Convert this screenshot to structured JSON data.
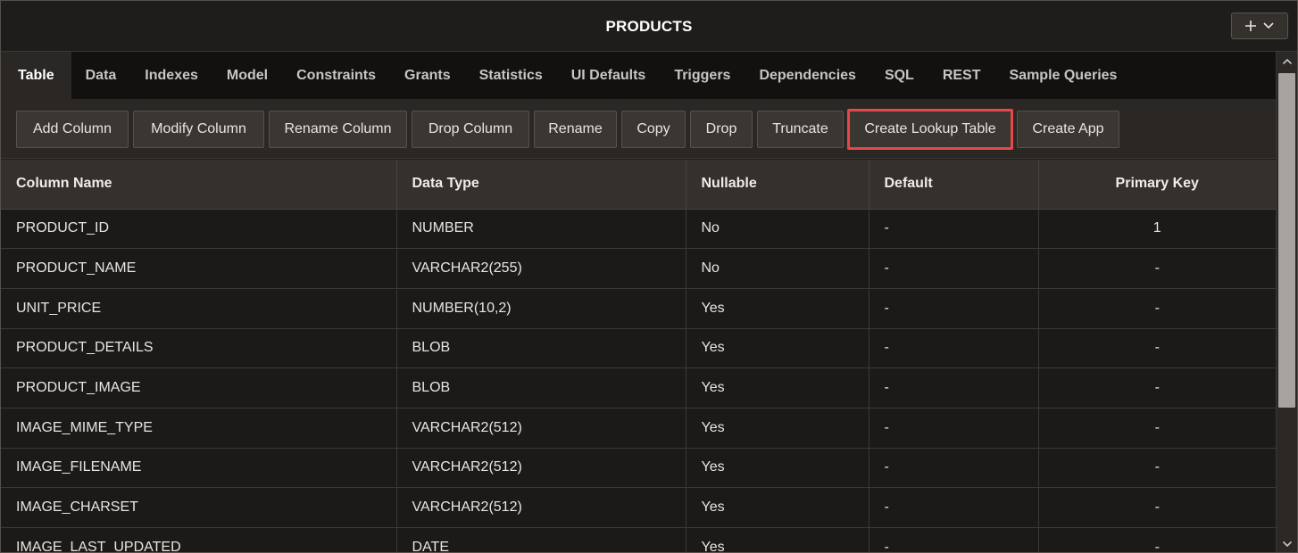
{
  "title": "PRODUCTS",
  "tabs": [
    {
      "label": "Table",
      "active": true
    },
    {
      "label": "Data"
    },
    {
      "label": "Indexes"
    },
    {
      "label": "Model"
    },
    {
      "label": "Constraints"
    },
    {
      "label": "Grants"
    },
    {
      "label": "Statistics"
    },
    {
      "label": "UI Defaults"
    },
    {
      "label": "Triggers"
    },
    {
      "label": "Dependencies"
    },
    {
      "label": "SQL"
    },
    {
      "label": "REST"
    },
    {
      "label": "Sample Queries"
    }
  ],
  "toolbar": {
    "buttons": [
      {
        "label": "Add Column"
      },
      {
        "label": "Modify Column"
      },
      {
        "label": "Rename Column"
      },
      {
        "label": "Drop Column"
      },
      {
        "label": "Rename"
      },
      {
        "label": "Copy"
      },
      {
        "label": "Drop"
      },
      {
        "label": "Truncate"
      },
      {
        "label": "Create Lookup Table",
        "highlighted": true
      },
      {
        "label": "Create App"
      }
    ]
  },
  "table": {
    "columns": [
      "Column Name",
      "Data Type",
      "Nullable",
      "Default",
      "Primary Key"
    ],
    "rows": [
      [
        "PRODUCT_ID",
        "NUMBER",
        "No",
        "-",
        "1"
      ],
      [
        "PRODUCT_NAME",
        "VARCHAR2(255)",
        "No",
        "-",
        "-"
      ],
      [
        "UNIT_PRICE",
        "NUMBER(10,2)",
        "Yes",
        "-",
        "-"
      ],
      [
        "PRODUCT_DETAILS",
        "BLOB",
        "Yes",
        "-",
        "-"
      ],
      [
        "PRODUCT_IMAGE",
        "BLOB",
        "Yes",
        "-",
        "-"
      ],
      [
        "IMAGE_MIME_TYPE",
        "VARCHAR2(512)",
        "Yes",
        "-",
        "-"
      ],
      [
        "IMAGE_FILENAME",
        "VARCHAR2(512)",
        "Yes",
        "-",
        "-"
      ],
      [
        "IMAGE_CHARSET",
        "VARCHAR2(512)",
        "Yes",
        "-",
        "-"
      ],
      [
        "IMAGE_LAST_UPDATED",
        "DATE",
        "Yes",
        "-",
        "-"
      ]
    ]
  },
  "icons": {
    "add": "plus-icon",
    "menu": "chevron-down-icon",
    "scroll_up": "arrow-up-icon",
    "scroll_down": "arrow-down-icon"
  },
  "colors": {
    "highlight": "#e8474a",
    "background": "#1c1a18",
    "header": "#34302c"
  }
}
